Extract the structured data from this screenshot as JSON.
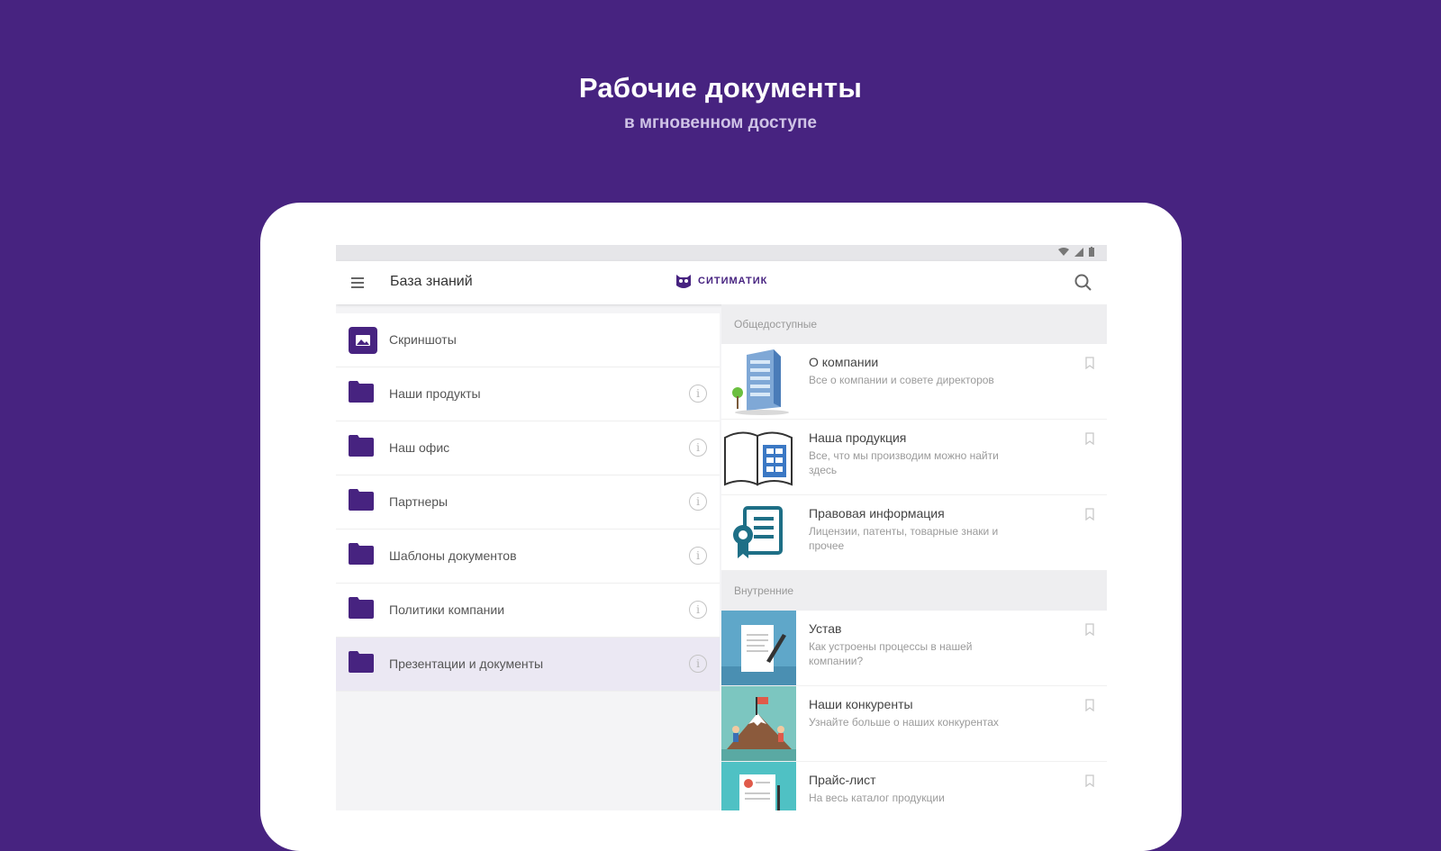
{
  "hero": {
    "title": "Рабочие документы",
    "subtitle": "в мгновенном доступе"
  },
  "appbar": {
    "title": "База знаний",
    "brand": "СИТИМАТИК"
  },
  "sidebar": {
    "items": [
      {
        "label": "Скриншоты",
        "icon": "image-icon"
      },
      {
        "label": "Наши продукты",
        "icon": "folder-icon"
      },
      {
        "label": "Наш офис",
        "icon": "folder-icon"
      },
      {
        "label": "Партнеры",
        "icon": "folder-icon"
      },
      {
        "label": "Шаблоны документов",
        "icon": "folder-icon"
      },
      {
        "label": "Политики компании",
        "icon": "folder-icon"
      },
      {
        "label": "Презентации и документы",
        "icon": "folder-icon"
      }
    ]
  },
  "sections": {
    "public": {
      "header": "Общедоступные",
      "docs": [
        {
          "title": "О компании",
          "desc": "Все о компании и совете директоров"
        },
        {
          "title": "Наша продукция",
          "desc": "Все, что мы производим можно найти здесь"
        },
        {
          "title": "Правовая информация",
          "desc": "Лицензии, патенты, товарные знаки и прочее"
        }
      ]
    },
    "internal": {
      "header": "Внутренние",
      "docs": [
        {
          "title": "Устав",
          "desc": "Как устроены процессы в нашей компании?"
        },
        {
          "title": "Наши конкуренты",
          "desc": "Узнайте больше о наших конкурентах"
        },
        {
          "title": "Прайс-лист",
          "desc": "На весь каталог продукции"
        }
      ]
    }
  },
  "colors": {
    "background": "#472380",
    "accent": "#472380",
    "active_row": "#ebe8f3"
  }
}
